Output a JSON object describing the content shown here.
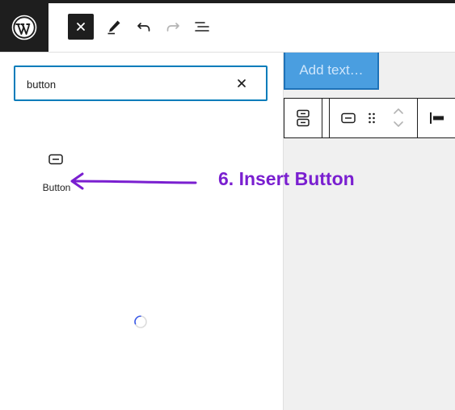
{
  "toolbar": {
    "logo_icon": "wordpress-logo-icon",
    "close_icon": "close-icon",
    "edit_icon": "pencil-icon",
    "undo_icon": "undo-icon",
    "redo_icon": "redo-icon",
    "list_view_icon": "list-view-icon"
  },
  "inserter": {
    "search_value": "button",
    "clear_icon": "close-icon",
    "results": [
      {
        "label": "Button",
        "icon": "button-block-icon"
      }
    ],
    "loading_icon": "spinner-icon"
  },
  "canvas": {
    "add_text_label": "Add text…",
    "block_toolbar_icons": [
      "buttons-block-icon",
      "button-block-icon",
      "drag-handle-icon",
      "move-up-icon",
      "move-down-icon",
      "align-left-icon"
    ]
  },
  "annotation": {
    "text": "6. Insert Button",
    "color": "#7a1fd0"
  }
}
